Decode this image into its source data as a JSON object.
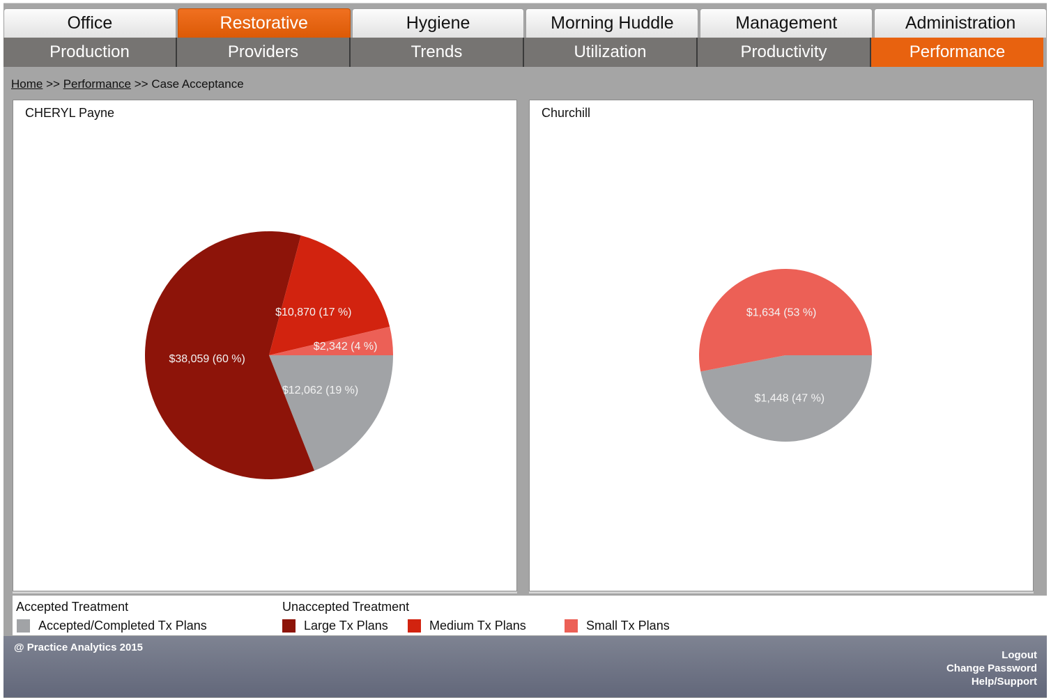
{
  "nav": {
    "top_tabs": [
      "Office",
      "Restorative",
      "Hygiene",
      "Morning Huddle",
      "Management",
      "Administration"
    ],
    "top_active": "Restorative",
    "sub_tabs": [
      "Production",
      "Providers",
      "Trends",
      "Utilization",
      "Productivity",
      "Performance"
    ],
    "sub_active": "Performance"
  },
  "breadcrumb": {
    "home": "Home",
    "sep1": ">>",
    "performance": "Performance",
    "sep2": ">>",
    "current": "Case Acceptance"
  },
  "colors": {
    "accepted": "#a1a3a6",
    "large": "#8d1409",
    "medium": "#d2230f",
    "small": "#ec6056",
    "accent_orange": "#e8620f"
  },
  "chart_data": [
    {
      "type": "pie",
      "title": "CHERYL Payne",
      "slices": [
        {
          "category": "Accepted/Completed Tx Plans",
          "value": 12062,
          "percent": 19,
          "label": "$12,062 (19 %)"
        },
        {
          "category": "Large Tx Plans",
          "value": 38059,
          "percent": 60,
          "label": "$38,059 (60 %)"
        },
        {
          "category": "Medium Tx Plans",
          "value": 10870,
          "percent": 17,
          "label": "$10,870 (17 %)"
        },
        {
          "category": "Small Tx Plans",
          "value": 2342,
          "percent": 4,
          "label": "$2,342 (4 %)"
        }
      ]
    },
    {
      "type": "pie",
      "title": "Churchill",
      "slices": [
        {
          "category": "Accepted/Completed Tx Plans",
          "value": 1448,
          "percent": 47,
          "label": "$1,448 (47 %)"
        },
        {
          "category": "Small Tx Plans",
          "value": 1634,
          "percent": 53,
          "label": "$1,634 (53 %)"
        }
      ]
    }
  ],
  "legend": {
    "accepted_heading": "Accepted Treatment",
    "unaccepted_heading": "Unaccepted Treatment",
    "items": [
      {
        "label": "Accepted/Completed Tx Plans",
        "color": "#a1a3a6"
      },
      {
        "label": "Large Tx Plans",
        "color": "#8d1409"
      },
      {
        "label": "Medium Tx Plans",
        "color": "#d2230f"
      },
      {
        "label": "Small Tx Plans",
        "color": "#ec6056"
      }
    ]
  },
  "footer": {
    "copyright": "@ Practice Analytics 2015",
    "links": [
      "Logout",
      "Change Password",
      "Help/Support"
    ]
  }
}
